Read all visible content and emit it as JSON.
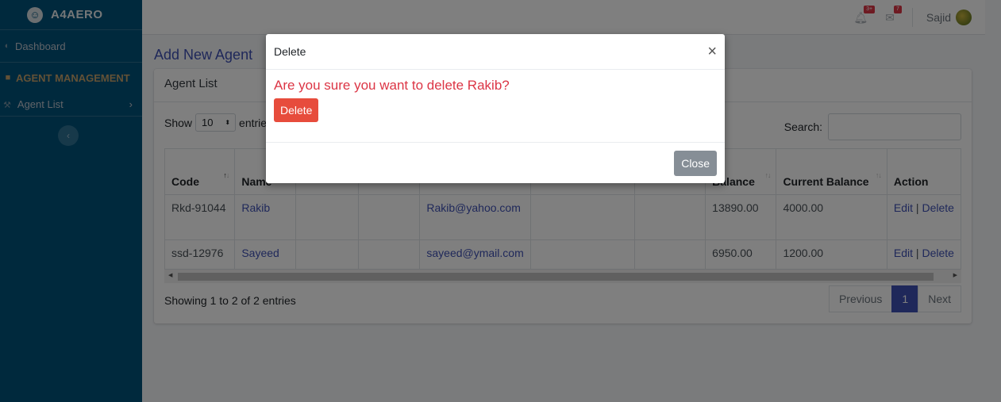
{
  "brand": {
    "name": "A4AERO"
  },
  "sidebar": {
    "dashboard_label": "Dashboard",
    "section_header": "AGENT MANAGEMENT",
    "agent_list_label": "Agent List"
  },
  "topbar": {
    "notifications_badge": "3+",
    "messages_badge": "7",
    "user_name": "Sajid"
  },
  "page": {
    "title": "Add New Agent"
  },
  "card": {
    "header": "Agent List",
    "show_label": "Show",
    "entries_value": "10",
    "entries_label": "entries",
    "search_label": "Search:"
  },
  "table": {
    "columns": [
      "Code",
      "Name",
      "",
      "",
      "",
      "",
      "",
      "Balance",
      "Current Balance",
      "Action"
    ],
    "rows": [
      {
        "code": "Rkd-91044",
        "name": "Rakib",
        "email": "Rakib@yahoo.com",
        "balance": "13890.00",
        "current_balance": "4000.00",
        "edit": "Edit",
        "sep": " | ",
        "delete": "Delete"
      },
      {
        "code": "ssd-12976",
        "name": "Sayeed",
        "email": "sayeed@ymail.com",
        "balance": "6950.00",
        "current_balance": "1200.00",
        "edit": "Edit",
        "sep": " | ",
        "delete": "Delete"
      }
    ],
    "info": "Showing 1 to 2 of 2 entries"
  },
  "pagination": {
    "previous": "Previous",
    "current": "1",
    "next": "Next"
  },
  "modal": {
    "title": "Delete",
    "close_symbol": "×",
    "message": "Are you sure you want to delete Rakib?",
    "delete_button": "Delete",
    "close_button": "Close"
  }
}
